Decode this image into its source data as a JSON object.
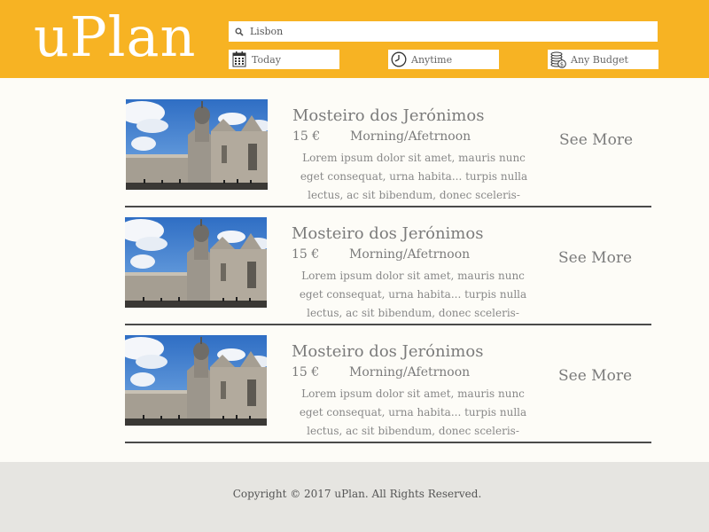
{
  "header": {
    "logo": "uPlan",
    "search": {
      "value": "Lisbon",
      "icon": "search-icon"
    },
    "filters": [
      {
        "label": "Today",
        "icon": "calendar-icon"
      },
      {
        "label": "Anytime",
        "icon": "clock-icon"
      },
      {
        "label": "Any Budget",
        "icon": "coins-icon"
      }
    ]
  },
  "results": [
    {
      "title": "Mosteiro dos Jerónimos",
      "price": "15 €",
      "period": "Morning/Afetrnoon",
      "description": "Lorem ipsum dolor sit amet, mauris nunc eget consequat, urna habita... turpis nulla lectus, ac sit bibendum, donec sceleris-",
      "action": "See More"
    },
    {
      "title": "Mosteiro dos Jerónimos",
      "price": "15 €",
      "period": "Morning/Afetrnoon",
      "description": "Lorem ipsum dolor sit amet, mauris nunc eget consequat, urna habita... turpis nulla lectus, ac sit bibendum, donec sceleris-",
      "action": "See More"
    },
    {
      "title": "Mosteiro dos Jerónimos",
      "price": "15 €",
      "period": "Morning/Afetrnoon",
      "description": "Lorem ipsum dolor sit amet, mauris nunc eget consequat, urna habita... turpis nulla lectus, ac sit bibendum, donec sceleris-",
      "action": "See More"
    }
  ],
  "footer": {
    "copyright": "Copyright © 2017 uPlan. All Rights Reserved."
  },
  "colors": {
    "brand": "#f7b323",
    "background": "#fdfcf7",
    "footer": "#e6e5e1",
    "text": "#7b7b7b"
  }
}
